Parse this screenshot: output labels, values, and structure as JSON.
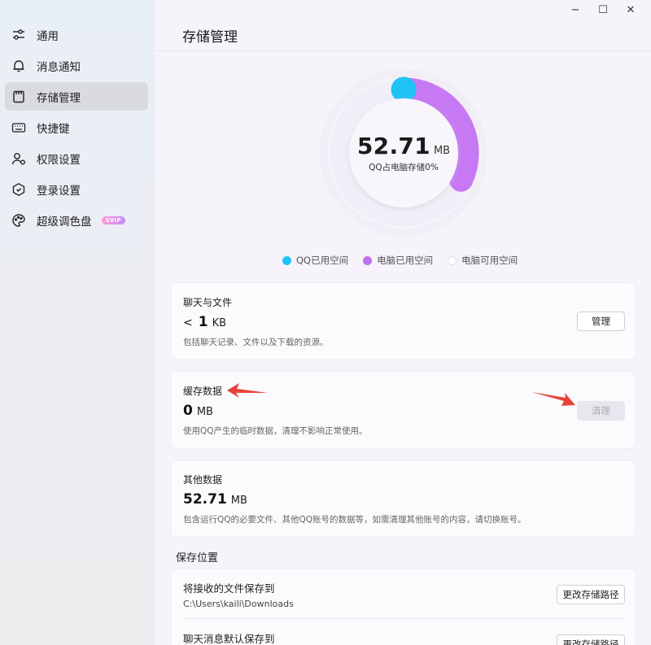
{
  "window": {
    "minimize_icon": "minimize-icon",
    "maximize_icon": "maximize-icon",
    "close_icon": "close-icon",
    "minimize_glyph": "−",
    "maximize_glyph": "☐",
    "close_glyph": "✕"
  },
  "sidebar": {
    "items": [
      {
        "label": "通用",
        "icon": "sliders-icon"
      },
      {
        "label": "消息通知",
        "icon": "bell-icon"
      },
      {
        "label": "存储管理",
        "icon": "storage-icon",
        "active": true
      },
      {
        "label": "快捷键",
        "icon": "keyboard-icon"
      },
      {
        "label": "权限设置",
        "icon": "user-lock-icon"
      },
      {
        "label": "登录设置",
        "icon": "shield-icon"
      },
      {
        "label": "超级调色盘",
        "icon": "palette-icon",
        "badge": "SVIP"
      }
    ]
  },
  "header": {
    "title": "存储管理"
  },
  "usage": {
    "value": "52.71",
    "unit": "MB",
    "caption": "QQ占电脑存储0%",
    "qq_fraction": 0.0,
    "computer_used_fraction": 0.32,
    "colors": {
      "qq": "#1fc3f5",
      "computer": "#c778f3",
      "free": "#f8f6fb"
    }
  },
  "legend": [
    {
      "label": "QQ已用空间",
      "color": "#1fc3f5"
    },
    {
      "label": "电脑已用空间",
      "color": "#c26ff0"
    },
    {
      "label": "电脑可用空间",
      "color": "#ffffff"
    }
  ],
  "chat_files": {
    "title": "聊天与文件",
    "prefix": "<",
    "value": "1",
    "unit": "KB",
    "desc": "包括聊天记录、文件以及下载的资源。",
    "button": "管理"
  },
  "cache": {
    "title": "缓存数据",
    "value": "0",
    "unit": "MB",
    "desc": "使用QQ产生的临时数据，清理不影响正常使用。",
    "button": "清理"
  },
  "other": {
    "title": "其他数据",
    "value": "52.71",
    "unit": "MB",
    "desc": "包含运行QQ的必要文件、其他QQ账号的数据等，如需清理其他账号的内容，请切换账号。"
  },
  "save_location": {
    "section": "保存位置",
    "rows": [
      {
        "title": "将接收的文件保存到",
        "path": "C:\\Users\\kaili\\Downloads",
        "button": "更改存储路径"
      },
      {
        "title": "聊天消息默认保存到",
        "button": "更改存储路径"
      }
    ]
  }
}
